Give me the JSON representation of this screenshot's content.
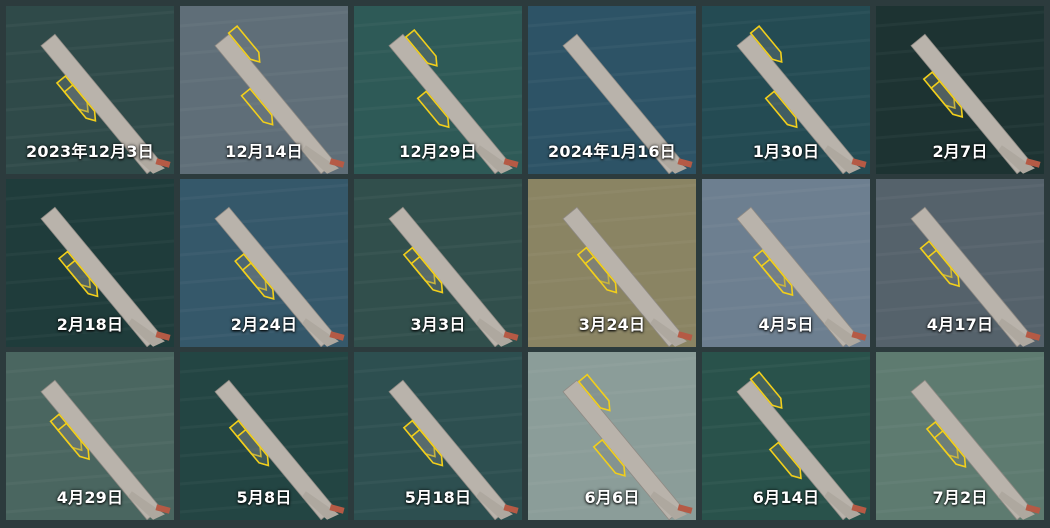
{
  "tiles": [
    {
      "date": "2023年12月3日",
      "bg": "#2f4a49",
      "boats": [
        {
          "along": 0.36,
          "side": 1
        },
        {
          "along": 0.43,
          "side": 1
        }
      ]
    },
    {
      "date": "12月14日",
      "bg": "#5f6e78",
      "boats": [
        {
          "along": 0.12,
          "side": -1
        },
        {
          "along": 0.46,
          "side": 1
        }
      ]
    },
    {
      "date": "12月29日",
      "bg": "#2e5a57",
      "boats": [
        {
          "along": 0.15,
          "side": -1
        },
        {
          "along": 0.48,
          "side": 1
        }
      ]
    },
    {
      "date": "2024年1月16日",
      "bg": "#2d5366",
      "boats": []
    },
    {
      "date": "1月30日",
      "bg": "#244b53",
      "boats": [
        {
          "along": 0.12,
          "side": -1
        },
        {
          "along": 0.48,
          "side": 1
        }
      ]
    },
    {
      "date": "2月7日",
      "bg": "#1d3332",
      "boats": [
        {
          "along": 0.33,
          "side": 1
        },
        {
          "along": 0.4,
          "side": 1
        }
      ]
    },
    {
      "date": "2月18日",
      "bg": "#1f3c3b",
      "boats": [
        {
          "along": 0.38,
          "side": 1
        },
        {
          "along": 0.45,
          "side": 1
        }
      ]
    },
    {
      "date": "2月24日",
      "bg": "#35586a",
      "boats": [
        {
          "along": 0.4,
          "side": 1
        },
        {
          "along": 0.47,
          "side": 1
        }
      ]
    },
    {
      "date": "3月3日",
      "bg": "#314f4c",
      "boats": [
        {
          "along": 0.35,
          "side": 1
        },
        {
          "along": 0.42,
          "side": 1
        }
      ]
    },
    {
      "date": "3月24日",
      "bg": "#8a8463",
      "boats": [
        {
          "along": 0.35,
          "side": 1
        },
        {
          "along": 0.42,
          "side": 1
        }
      ]
    },
    {
      "date": "4月5日",
      "bg": "#6d7f90",
      "boats": [
        {
          "along": 0.37,
          "side": 1
        },
        {
          "along": 0.44,
          "side": 1
        }
      ]
    },
    {
      "date": "4月17日",
      "bg": "#55626b",
      "boats": [
        {
          "along": 0.3,
          "side": 1
        },
        {
          "along": 0.37,
          "side": 1
        }
      ]
    },
    {
      "date": "4月29日",
      "bg": "#4a6660",
      "boats": [
        {
          "along": 0.3,
          "side": 1
        },
        {
          "along": 0.37,
          "side": 1
        }
      ]
    },
    {
      "date": "5月8日",
      "bg": "#234543",
      "boats": [
        {
          "along": 0.35,
          "side": 1
        },
        {
          "along": 0.42,
          "side": 1
        }
      ]
    },
    {
      "date": "5月18日",
      "bg": "#2d4f50",
      "boats": [
        {
          "along": 0.35,
          "side": 1
        },
        {
          "along": 0.42,
          "side": 1
        }
      ]
    },
    {
      "date": "6月6日",
      "bg": "#8b9d99",
      "boats": [
        {
          "along": 0.14,
          "side": -1
        },
        {
          "along": 0.5,
          "side": 1
        }
      ]
    },
    {
      "date": "6月14日",
      "bg": "#29524b",
      "boats": [
        {
          "along": 0.12,
          "side": -1
        },
        {
          "along": 0.52,
          "side": 1
        }
      ]
    },
    {
      "date": "7月2日",
      "bg": "#5e7b70",
      "boats": [
        {
          "along": 0.36,
          "side": 1
        },
        {
          "along": 0.43,
          "side": 1
        }
      ]
    }
  ]
}
